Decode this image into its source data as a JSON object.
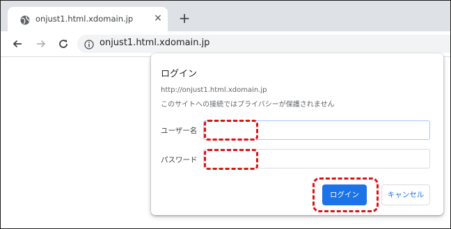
{
  "browser": {
    "tab_title": "onjust1.html.xdomain.jp",
    "tab_close": "×",
    "new_tab": "+",
    "url": "onjust1.html.xdomain.jp"
  },
  "dialog": {
    "title": "ログイン",
    "origin": "http://onjust1.html.xdomain.jp",
    "warning": "このサイトへの接続ではプライバシーが保護されません",
    "username_label": "ユーザー名",
    "username_value": "",
    "password_label": "パスワード",
    "password_value": "",
    "login_button": "ログイン",
    "cancel_button": "キャンセル"
  },
  "colors": {
    "accent": "#1a73e8",
    "highlight": "#e01010",
    "tabstrip": "#dee1e6"
  },
  "icons": [
    "globe-favicon-icon",
    "close-icon",
    "plus-icon",
    "back-arrow-icon",
    "forward-arrow-icon",
    "reload-icon",
    "info-icon"
  ]
}
